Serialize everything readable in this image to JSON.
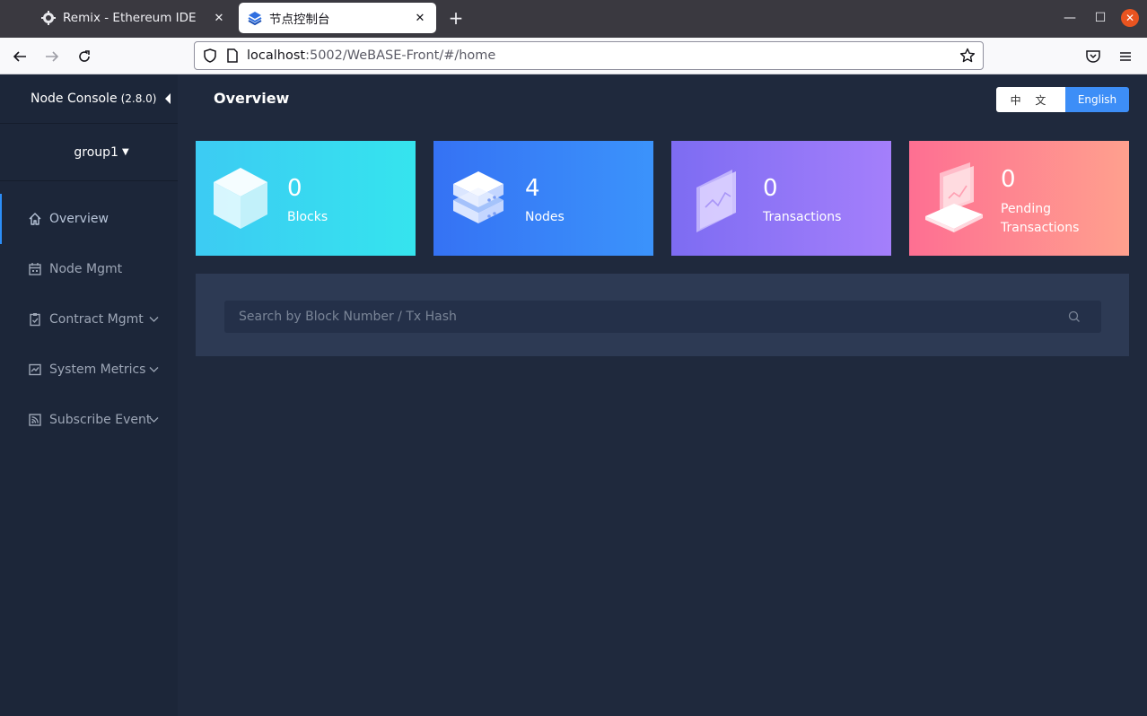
{
  "browser": {
    "tabs": [
      {
        "title": "Remix - Ethereum IDE",
        "close": "✕"
      },
      {
        "title": "节点控制台",
        "close": "✕"
      }
    ],
    "new_tab": "+",
    "url_host": "localhost",
    "url_rest": ":5002/WeBASE-Front/#/home",
    "window_controls": {
      "minimize": "—",
      "maximize": "☐",
      "close": "✕"
    }
  },
  "sidebar": {
    "brand": "Node Console",
    "version": "(2.8.0)",
    "group": "group1",
    "items": [
      {
        "label": "Overview",
        "icon": "home-icon",
        "active": true
      },
      {
        "label": "Node Mgmt",
        "icon": "calendar-icon"
      },
      {
        "label": "Contract Mgmt",
        "icon": "clipboard-icon",
        "expandable": true
      },
      {
        "label": "System Metrics",
        "icon": "chart-icon",
        "expandable": true
      },
      {
        "label": "Subscribe Event",
        "icon": "rss-icon",
        "expandable": true
      }
    ]
  },
  "header": {
    "title": "Overview",
    "lang_zh": "中 文",
    "lang_en": "English"
  },
  "cards": [
    {
      "value": "0",
      "label": "Blocks",
      "color_from": "#3ccbf3",
      "color_to": "#35e4ee"
    },
    {
      "value": "4",
      "label": "Nodes",
      "color_from": "#3572f4",
      "color_to": "#3b93fb"
    },
    {
      "value": "0",
      "label": "Transactions",
      "color_from": "#7d6cf2",
      "color_to": "#a47ffb"
    },
    {
      "value": "0",
      "label": "Pending Transactions",
      "color_from": "#fe6f92",
      "color_to": "#ffa08e"
    }
  ],
  "search": {
    "placeholder": "Search by Block Number / Tx Hash"
  },
  "colors": {
    "accent": "#3d8ef7",
    "background": "#1f293d",
    "sidebar": "#1c2639"
  }
}
